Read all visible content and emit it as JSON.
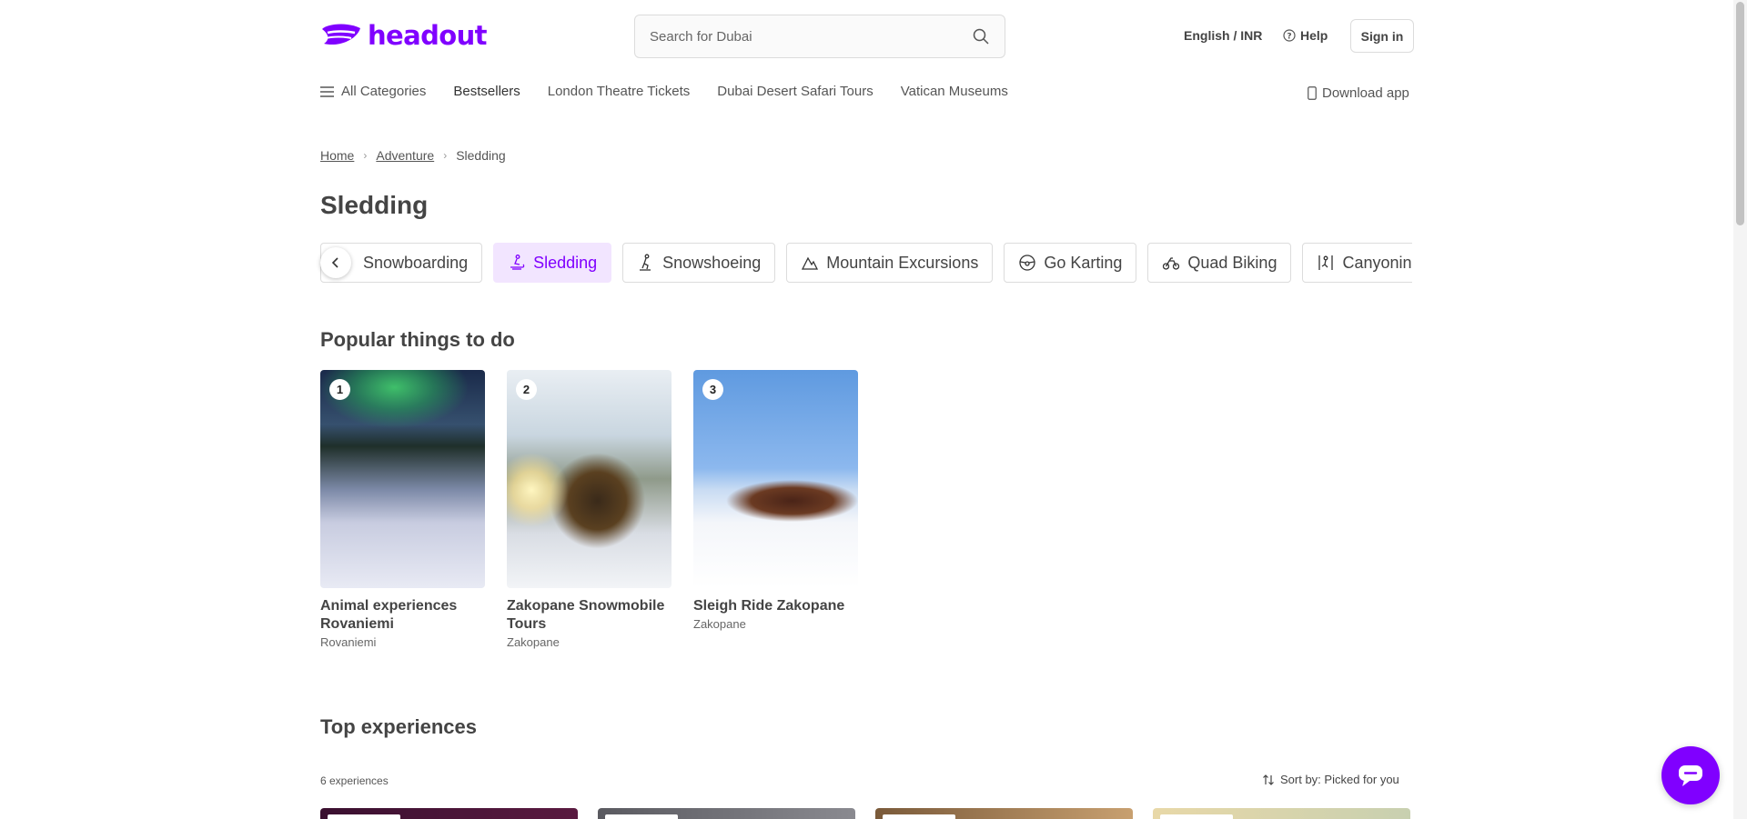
{
  "header": {
    "logo_text": "headout",
    "search_placeholder": "Search for Dubai",
    "language_currency": "English / INR",
    "help_label": "Help",
    "signin_label": "Sign in"
  },
  "category_nav": {
    "all_label": "All Categories",
    "items": [
      "Bestsellers",
      "London Theatre Tickets",
      "Dubai Desert Safari Tours",
      "Vatican Museums"
    ],
    "download_label": "Download app"
  },
  "breadcrumb": {
    "home": "Home",
    "parent": "Adventure",
    "current": "Sledding"
  },
  "page_title": "Sledding",
  "chips": [
    {
      "label": "Snowboarding",
      "icon": "snowboard-icon",
      "active": false
    },
    {
      "label": "Sledding",
      "icon": "sled-icon",
      "active": true
    },
    {
      "label": "Snowshoeing",
      "icon": "snowshoe-icon",
      "active": false
    },
    {
      "label": "Mountain Excursions",
      "icon": "mountain-icon",
      "active": false
    },
    {
      "label": "Go Karting",
      "icon": "steering-wheel-icon",
      "active": false
    },
    {
      "label": "Quad Biking",
      "icon": "quad-bike-icon",
      "active": false
    },
    {
      "label": "Canyoning",
      "icon": "canyoning-icon",
      "active": false
    }
  ],
  "popular": {
    "title": "Popular things to do",
    "cards": [
      {
        "rank": "1",
        "title": "Animal experiences Rovaniemi",
        "location": "Rovaniemi"
      },
      {
        "rank": "2",
        "title": "Zakopane Snowmobile Tours",
        "location": "Zakopane"
      },
      {
        "rank": "3",
        "title": "Sleigh Ride Zakopane",
        "location": "Zakopane"
      }
    ]
  },
  "top_experiences": {
    "title": "Top experiences",
    "count_label": "6 experiences",
    "sort_label": "Sort by: Picked for you"
  },
  "colors": {
    "brand": "#8000ff",
    "chip_active_bg": "#f2e5ff",
    "text": "#444444"
  }
}
